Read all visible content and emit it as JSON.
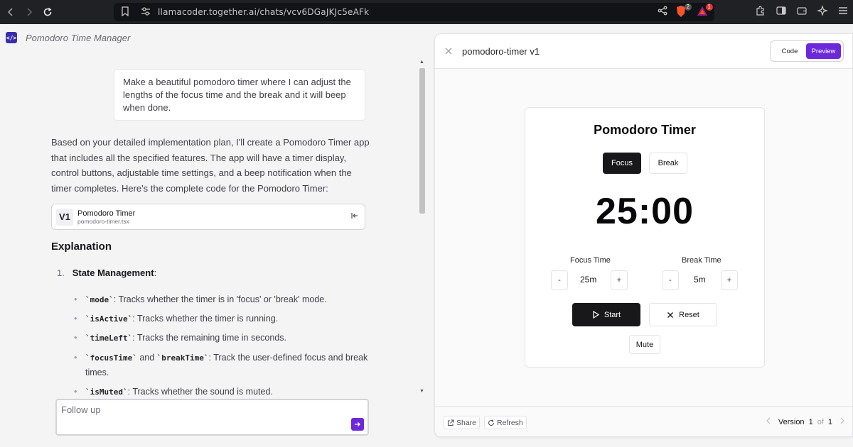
{
  "browser": {
    "url": "llamacoder.together.ai/chats/vcv6DGaJKJc5eAFk",
    "badge_shields": "2",
    "badge_rewards": "1"
  },
  "app": {
    "title": "Pomodoro Time Manager"
  },
  "chat": {
    "user_message": "Make a beautiful pomodoro timer where I can adjust the lengths of the focus time and the break and it will beep when done.",
    "assistant_intro": "Based on your detailed implementation plan, I'll create a Pomodoro Timer app that includes all the specified features. The app will have a timer display, control buttons, adjustable time settings, and a beep notification when the timer completes. Here's the complete code for the Pomodoro Timer:",
    "artifact": {
      "version": "V1",
      "title": "Pomodoro Timer",
      "filename": "pomodoro-timer.tsx"
    },
    "explanation_heading": "Explanation",
    "list_number": "1.",
    "list_title": "State Management",
    "list_colon": ":",
    "bullets": [
      {
        "code": "`mode`",
        "text": ": Tracks whether the timer is in 'focus' or 'break' mode."
      },
      {
        "code": "`isActive`",
        "text": ": Tracks whether the timer is running."
      },
      {
        "code": "`timeLeft`",
        "text": ": Tracks the remaining time in seconds."
      },
      {
        "code": "`focusTime`",
        "mid": " and ",
        "code2": "`breakTime`",
        "text": ": Track the user-defined focus and break times."
      },
      {
        "code": "`isMuted`",
        "text": ": Tracks whether the sound is muted."
      }
    ],
    "followup_placeholder": "Follow up"
  },
  "preview": {
    "title": "pomodoro-timer v1",
    "tab_code": "Code",
    "tab_preview": "Preview",
    "card": {
      "title": "Pomodoro Timer",
      "mode_focus": "Focus",
      "mode_break": "Break",
      "time": "25:00",
      "focus_label": "Focus Time",
      "break_label": "Break Time",
      "focus_value": "25m",
      "break_value": "5m",
      "minus": "-",
      "plus": "+",
      "start": "Start",
      "reset": "Reset",
      "mute": "Mute"
    },
    "footer": {
      "share": "Share",
      "refresh": "Refresh",
      "version_label": "Version",
      "version_current": "1",
      "version_of": "of",
      "version_total": "1"
    }
  },
  "colors": {
    "accent": "#6d28d9",
    "dark_button": "#18181b"
  }
}
